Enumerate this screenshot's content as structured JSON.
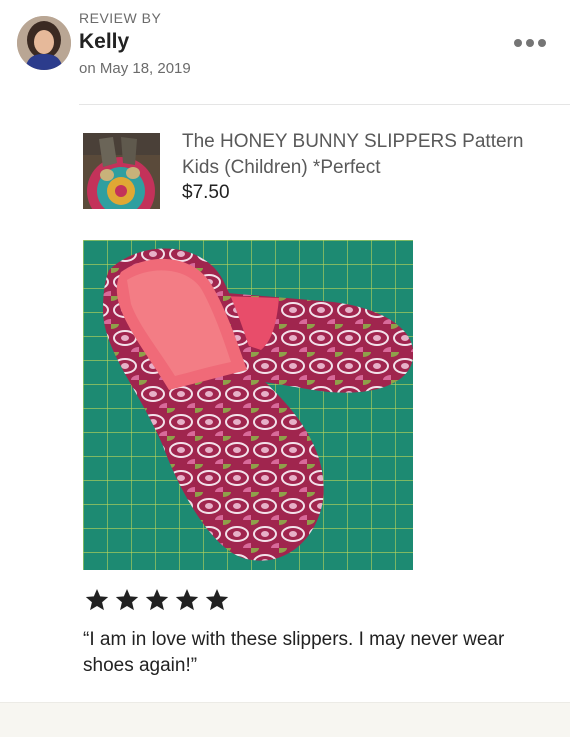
{
  "review": {
    "heading": "REVIEW BY",
    "reviewer_name": "Kelly",
    "date": "on May 18, 2019",
    "rating": 5,
    "text": "“I am in love with these slippers. I may never wear shoes again!”"
  },
  "listing": {
    "title": "The HONEY BUNNY SLIPPERS Pattern Kids (Children) *Perfect",
    "price": "$7.50"
  },
  "icons": {
    "more": "more-options-icon",
    "star": "star-icon"
  },
  "colors": {
    "star": "#222222",
    "muted_text": "#6b6b6b",
    "divider": "#e5e5e5"
  }
}
